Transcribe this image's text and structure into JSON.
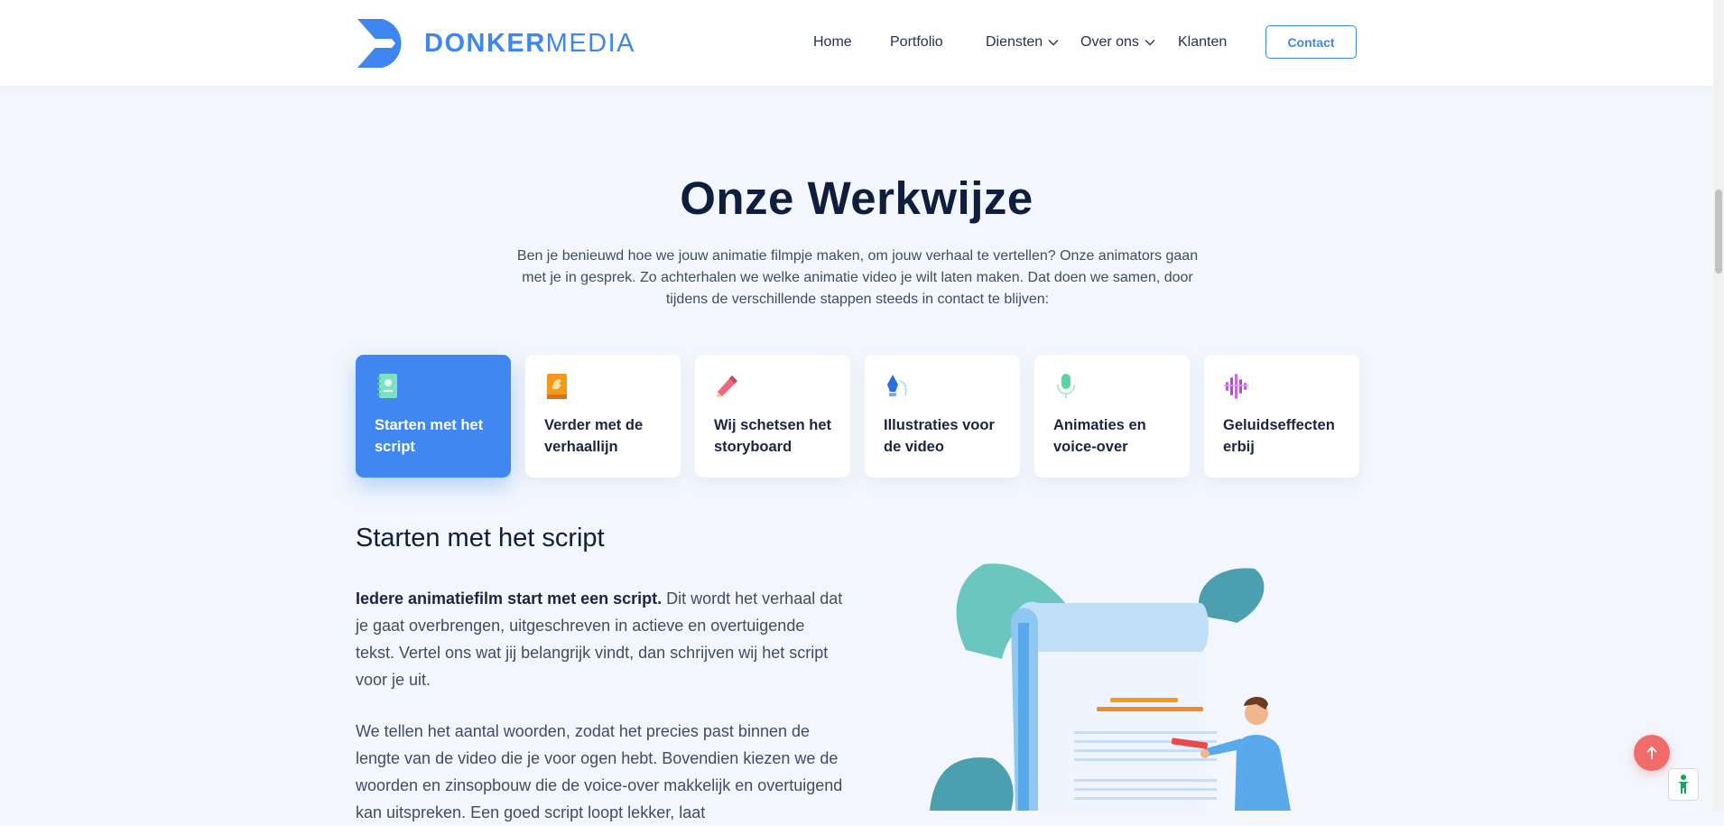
{
  "header": {
    "logo": {
      "text_bold": "DONKER",
      "text_light": "MEDIA"
    },
    "nav": [
      {
        "label": "Home"
      },
      {
        "label": "Portfolio"
      },
      {
        "label": "Diensten",
        "has_dropdown": true
      },
      {
        "label": "Over ons",
        "has_dropdown": true
      },
      {
        "label": "Klanten"
      }
    ],
    "contact_label": "Contact"
  },
  "section": {
    "title": "Onze Werkwijze",
    "intro": "Ben je benieuwd hoe we jouw animatie filmpje maken, om jouw verhaal te vertellen? Onze animators gaan met je in gesprek. Zo achterhalen we welke animatie video je wilt laten maken. Dat doen we samen, door tijdens de verschillende stappen steeds in contact te blijven:"
  },
  "steps": [
    {
      "label": "Starten met het script",
      "icon": "notebook-icon",
      "active": true
    },
    {
      "label": "Verder met de verhaallijn",
      "icon": "book-icon",
      "active": false
    },
    {
      "label": "Wij schetsen het storyboard",
      "icon": "pencil-icon",
      "active": false
    },
    {
      "label": "Illustraties voor de video",
      "icon": "pen-nib-icon",
      "active": false
    },
    {
      "label": "Animaties en voice-over",
      "icon": "microphone-icon",
      "active": false
    },
    {
      "label": "Geluidseffecten erbij",
      "icon": "sound-wave-icon",
      "active": false
    }
  ],
  "content": {
    "title": "Starten met het script",
    "para1_bold": "Iedere animatiefilm start met een script.",
    "para1_rest": " Dit wordt het verhaal dat je gaat overbrengen, uitgeschreven in actieve en overtuigende tekst. Vertel ons wat jij belangrijk vindt, dan schrijven wij het script voor je uit.",
    "para2": "We tellen het aantal woorden, zodat het precies past binnen de lengte van de video die je voor ogen hebt. Bovendien kiezen we de woorden en zinsopbouw die de voice-over makkelijk en overtuigend kan uitspreken. Een goed script loopt lekker, laat"
  },
  "colors": {
    "brand": "#3f86f0",
    "active_card": "#4187f2",
    "scroll_top": "#f16b6b"
  }
}
